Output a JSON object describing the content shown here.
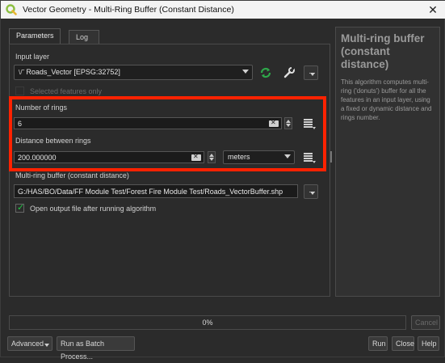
{
  "window": {
    "title": "Vector Geometry - Multi-Ring Buffer (Constant Distance)",
    "close_glyph": "✕"
  },
  "tabs": [
    {
      "label": "Parameters",
      "active": true
    },
    {
      "label": "Log",
      "active": false
    }
  ],
  "params": {
    "input_layer_label": "Input layer",
    "input_layer_value": "Roads_Vector [EPSG:32752]",
    "selected_only_label": "Selected features only",
    "selected_only_checked": false,
    "rings_label": "Number of rings",
    "rings_value": "6",
    "distance_label": "Distance between rings",
    "distance_value": "200.000000",
    "distance_unit": "meters",
    "output_label": "Multi-ring buffer (constant distance)",
    "output_value": "G:/HAS/BO/Data/FF Module Test/Forest Fire Module Test/Roads_VectorBuffer.shp",
    "open_output_label": "Open output file after running algorithm",
    "open_output_checked": true,
    "more_glyph": "…"
  },
  "help": {
    "title": "Multi-ring buffer (constant distance)",
    "text": "This algorithm computes multi-ring ('donuts') buffer for all the features in an input layer, using a fixed or dynamic distance and rings number."
  },
  "progress": {
    "percent": 0,
    "label": "0%"
  },
  "buttons": {
    "cancel": "Cancel",
    "advanced": "Advanced",
    "batch": "Run as Batch Process...",
    "run": "Run",
    "close": "Close",
    "help": "Help"
  },
  "colors": {
    "highlight": "#ff2200",
    "accent_green": "#1ec943",
    "background": "#2b2b2b"
  }
}
